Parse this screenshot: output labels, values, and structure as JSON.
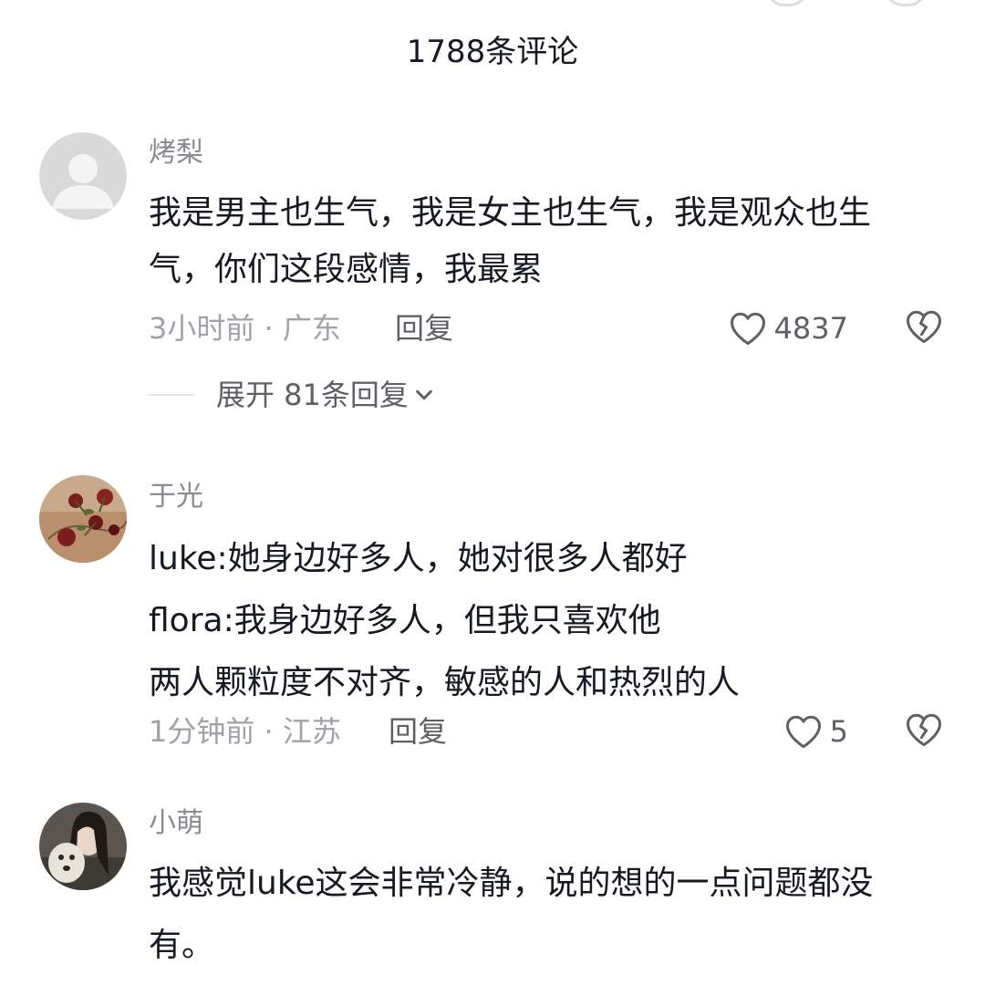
{
  "header": {
    "comment_count_title": "1788条评论"
  },
  "comments": [
    {
      "username": "烤梨",
      "avatar": "default-avatar-icon",
      "lines": [
        "我是男主也生气，我是女主也生气，我是观众也生",
        "气，你们这段感情，我最累"
      ],
      "meta": "3小时前 · 广东",
      "reply_label": "回复",
      "likes": "4837",
      "expand_label": "展开 81条回复"
    },
    {
      "username": "于光",
      "avatar": "roses-photo-avatar",
      "lines": [
        "luke:她身边好多人，她对很多人都好",
        "flora:我身边好多人，但我只喜欢他",
        "两人颗粒度不对齐，敏感的人和热烈的人"
      ],
      "meta": "1分钟前 · 江苏",
      "reply_label": "回复",
      "likes": "5"
    },
    {
      "username": "小萌",
      "avatar": "girl-with-dog-photo-avatar",
      "lines": [
        "我感觉luke这会非常冷静，说的想的一点问题都没",
        "有。"
      ]
    }
  ],
  "colors": {
    "text_primary": "#161823",
    "text_secondary": "#8a8b91",
    "text_meta": "#a1a2a7",
    "icon_gray": "#5f6066"
  }
}
